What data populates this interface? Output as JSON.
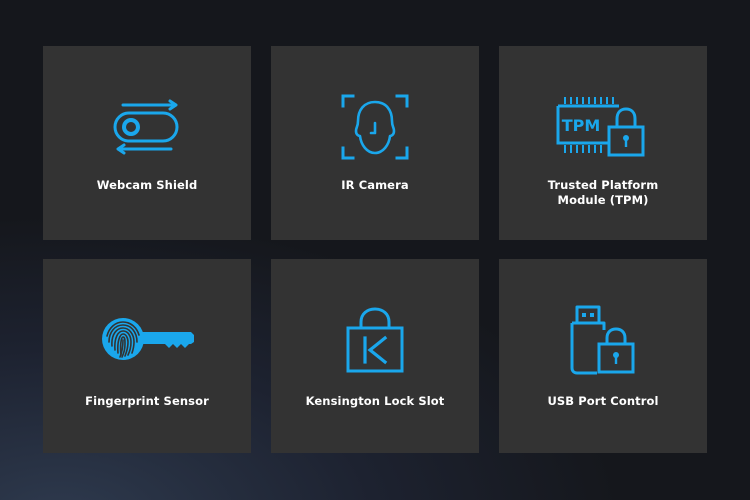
{
  "accent_color": "#1aa7ec",
  "tile_color": "#333333",
  "features": [
    {
      "label": "Webcam Shield",
      "icon": "webcam-shield-icon"
    },
    {
      "label": "IR Camera",
      "icon": "face-scan-icon"
    },
    {
      "label_line1": "Trusted Platform",
      "label_line2": "Module (TPM)",
      "icon_text": "TPM",
      "icon": "tpm-chip-lock-icon"
    },
    {
      "label": "Fingerprint Sensor",
      "icon": "fingerprint-key-icon"
    },
    {
      "label": "Kensington Lock Slot",
      "icon_text": "K",
      "icon": "kensington-lock-icon"
    },
    {
      "label": "USB Port Control",
      "icon": "usb-lock-icon"
    }
  ]
}
